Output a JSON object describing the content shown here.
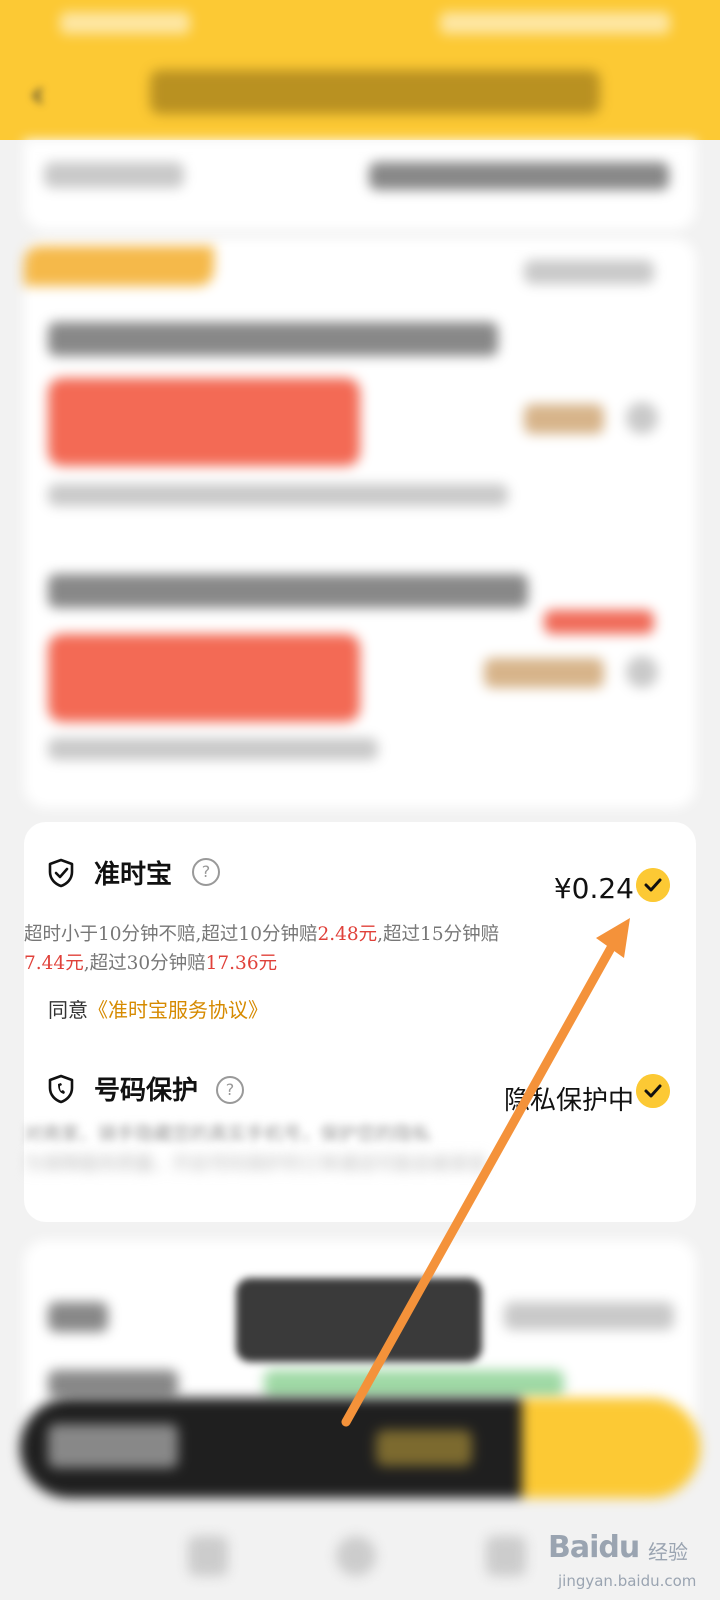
{
  "on_time": {
    "title": "准时宝",
    "price": "¥0.24",
    "desc_part1": "超时小于10分钟不赔,超过10分钟赔",
    "amount1": "2.48元",
    "desc_part2": ",超过15分钟赔",
    "amount2": "7.44元",
    "desc_part3": ",超过30分钟赔",
    "amount3": "17.36元",
    "agree_prefix": "同意",
    "agreement_link": "《准时宝服务协议》"
  },
  "number_protect": {
    "title": "号码保护",
    "status": "隐私保护中",
    "desc_line1": "对商家、骑手隐藏您的真实手机号，保护您的隐私",
    "desc_line2": "为保障服务质量，开启号码保护的订单通话可能会被录音"
  },
  "watermark": {
    "brand": "Baidu",
    "sub": "经验",
    "url": "jingyan.baidu.com"
  },
  "colors": {
    "header": "#fcc934",
    "accent_red": "#e0413a",
    "link": "#d68a00",
    "arrow": "#f4923a"
  }
}
